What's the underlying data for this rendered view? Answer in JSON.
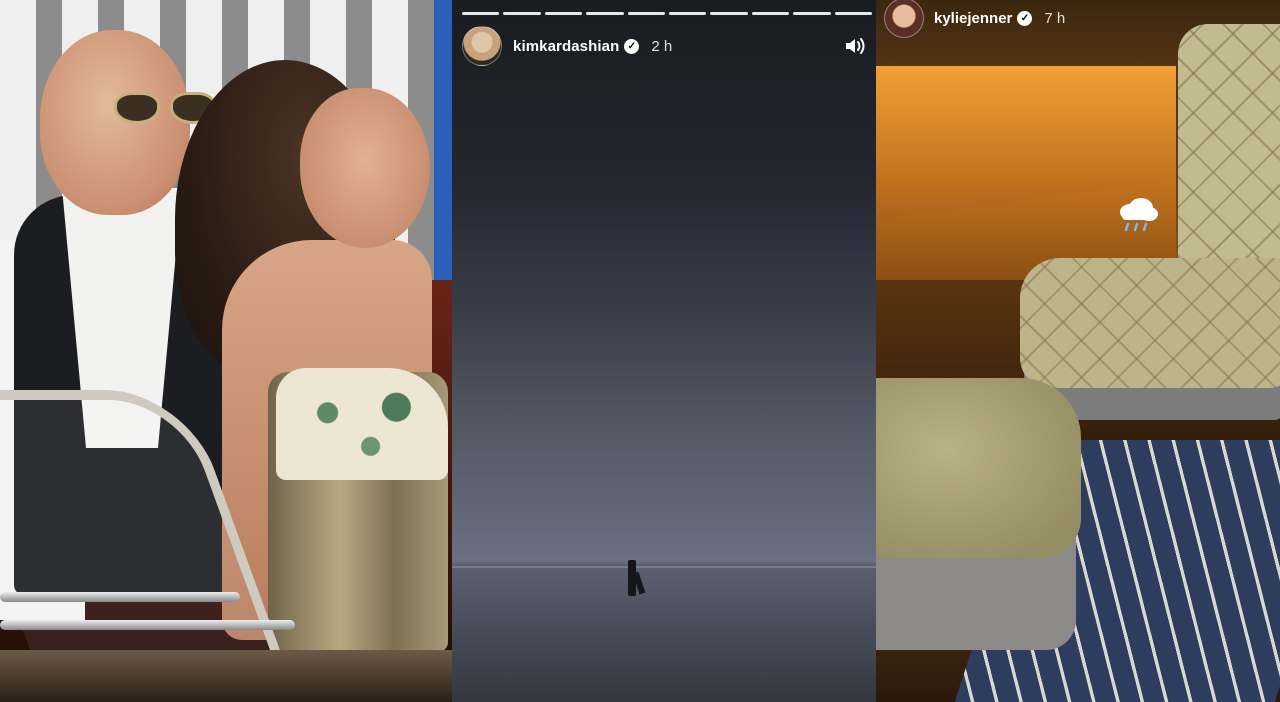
{
  "left_photo": {
    "icon": "photo-couple-on-boat"
  },
  "kim_story": {
    "progress_segments": 10,
    "username": "kimkardashian",
    "verified_icon": "verified-badge-icon",
    "timestamp": "2 h",
    "sound_icon": "speaker-volume-icon"
  },
  "kylie_story": {
    "username": "kyliejenner",
    "verified_icon": "verified-badge-icon",
    "timestamp": "7 h",
    "sticker_icon": "rain-cloud-icon"
  },
  "colors": {
    "verified_fill": "#ffffff",
    "text": "#ffffff"
  }
}
